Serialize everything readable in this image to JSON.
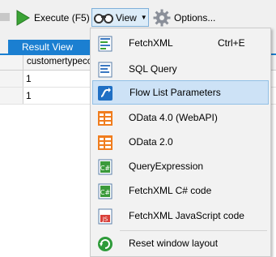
{
  "toolbar": {
    "execute_label": "Execute (F5)",
    "view_label": "View",
    "options_label": "Options..."
  },
  "result_tab": {
    "label": "Result View",
    "close": "✕"
  },
  "grid": {
    "column_header": "customertypecod",
    "rows": [
      {
        "value": "1"
      },
      {
        "value": "1"
      }
    ]
  },
  "view_menu": {
    "items": [
      {
        "label": "FetchXML",
        "shortcut": "Ctrl+E",
        "icon": "fetchxml-doc-icon"
      },
      {
        "label": "SQL Query",
        "icon": "sql-doc-icon"
      },
      {
        "label": "Flow List Parameters",
        "icon": "flow-icon",
        "highlighted": true
      },
      {
        "label": "OData 4.0 (WebAPI)",
        "icon": "odata-icon"
      },
      {
        "label": "OData 2.0",
        "icon": "odata-icon"
      },
      {
        "label": "QueryExpression",
        "icon": "csharp-doc-icon"
      },
      {
        "label": "FetchXML C# code",
        "icon": "csharp-doc-icon"
      },
      {
        "label": "FetchXML JavaScript code",
        "icon": "js-doc-icon"
      },
      {
        "label": "Reset window layout",
        "icon": "reset-layout-icon"
      }
    ]
  },
  "colors": {
    "accent": "#1b7fd1",
    "menu_highlight": "#cde2f6",
    "execute_green": "#3aa335",
    "odata_orange": "#f07d1e"
  }
}
